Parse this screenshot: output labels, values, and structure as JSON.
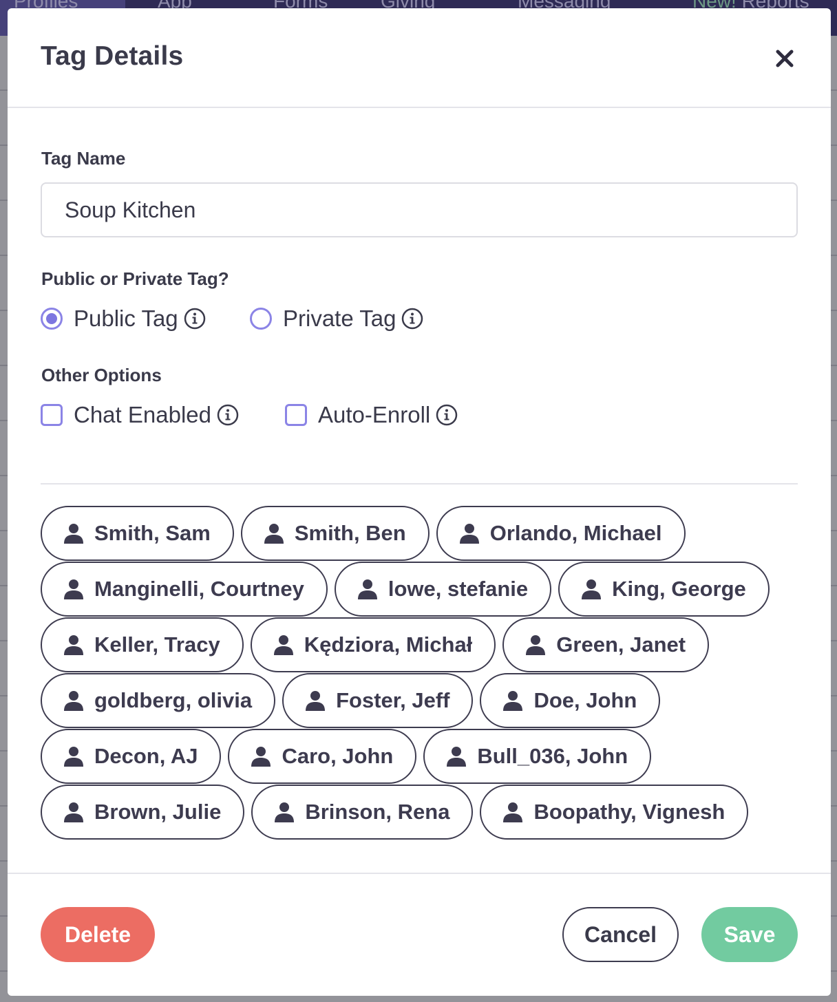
{
  "background_nav": {
    "items": [
      {
        "label": "Profiles",
        "active": true
      },
      {
        "label": "App"
      },
      {
        "label": "Forms"
      },
      {
        "label": "Giving"
      },
      {
        "label": "Messaging"
      }
    ],
    "reports": {
      "badge": "New!",
      "label": "Reports"
    }
  },
  "modal": {
    "title": "Tag Details",
    "close_icon": "close-icon"
  },
  "tag_name": {
    "label": "Tag Name",
    "value": "Soup Kitchen",
    "placeholder": ""
  },
  "visibility": {
    "label": "Public or Private Tag?",
    "options": [
      {
        "label": "Public Tag",
        "checked": true,
        "icon": "info-icon"
      },
      {
        "label": "Private Tag",
        "checked": false,
        "icon": "info-icon"
      }
    ]
  },
  "other_options": {
    "label": "Other Options",
    "options": [
      {
        "label": "Chat Enabled",
        "checked": false,
        "icon": "info-icon"
      },
      {
        "label": "Auto-Enroll",
        "checked": false,
        "icon": "info-icon"
      }
    ]
  },
  "members": [
    [
      "Smith, Sam",
      "Smith, Ben",
      "Orlando, Michael"
    ],
    [
      "Manginelli, Courtney",
      "lowe, stefanie",
      "King, George"
    ],
    [
      "Keller, Tracy",
      "Kędziora, Michał",
      "Green, Janet"
    ],
    [
      "goldberg, olivia",
      "Foster, Jeff",
      "Doe, John"
    ],
    [
      "Decon, AJ",
      "Caro, John",
      "Bull_036, John"
    ],
    [
      "Brown, Julie",
      "Brinson, Rena",
      "Boopathy, Vignesh"
    ]
  ],
  "member_icon": "person-icon",
  "footer": {
    "delete_label": "Delete",
    "cancel_label": "Cancel",
    "save_label": "Save"
  },
  "colors": {
    "accent_purple": "#7d76e0",
    "delete_red": "#ec6d63",
    "save_green": "#72cba0",
    "text_dark": "#3a3a4a"
  }
}
